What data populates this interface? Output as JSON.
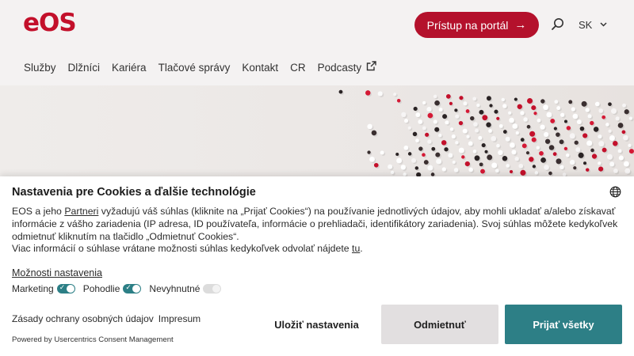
{
  "header": {
    "logo": "eOS",
    "portal_button": "Prístup na portál",
    "portal_arrow": "→",
    "language": "SK",
    "language_chevron": "⌄",
    "nav": [
      {
        "label": "Služby"
      },
      {
        "label": "Dlžníci"
      },
      {
        "label": "Kariéra"
      },
      {
        "label": "Tlačové správy"
      },
      {
        "label": "Kontakt"
      },
      {
        "label": "CR"
      },
      {
        "label": "Podcasty",
        "icon": "external-link-icon"
      }
    ]
  },
  "cookie": {
    "title": "Nastavenia pre Cookies a ďalšie technológie",
    "text_1_before": "EOS a jeho ",
    "partners_link": "Partneri",
    "text_1_after": " vyžadujú váš súhlas (kliknite na „Prijať Cookies“) na používanie jednotlivých údajov, aby mohli ukladať a/alebo získavať informácie z vášho zariadenia (IP adresa, ID používateľa, informácie o prehliadači, identifikátory zariadenia). Svoj súhlas môžete kedykoľvek odmietnuť kliknutím na tlačidlo „Odmietnuť Cookies“.",
    "text_2_before": "Viac informácií o súhlase vrátane možnosti súhlas kedykoľvek odvolať nájdete ",
    "here_link": "tu",
    "text_2_after": ".",
    "settings_link": "Možnosti nastavenia",
    "toggles": [
      {
        "label": "Marketing",
        "state": "on"
      },
      {
        "label": "Pohodlie",
        "state": "on"
      },
      {
        "label": "Nevyhnutné",
        "state": "on-disabled"
      }
    ],
    "privacy_link": "Zásady ochrany osobných údajov",
    "imprint_link": "Impresum",
    "powered_by": "Powered by Usercentrics Consent Management",
    "save_button": "Uložiť nastavenia",
    "deny_button": "Odmietnuť",
    "accept_button": "Prijať všetky"
  },
  "colors": {
    "brand_red": "#c3102b",
    "teal": "#2d7f86",
    "deny_bg": "#e2dfe0"
  }
}
